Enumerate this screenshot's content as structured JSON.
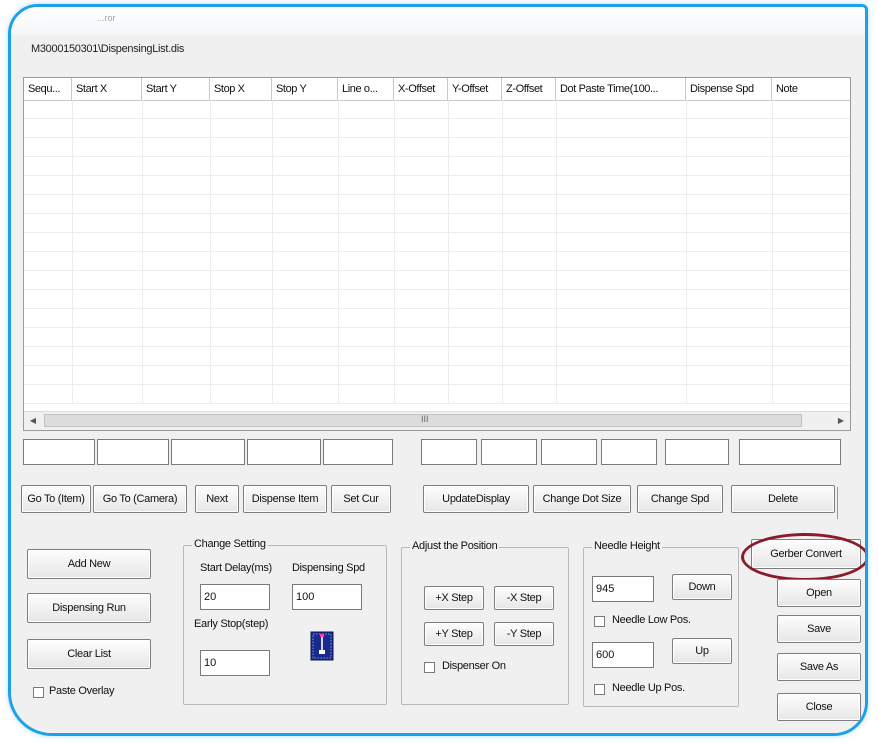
{
  "window": {
    "title": "...ror",
    "path": "M3000150301\\DispensingList.dis"
  },
  "grid": {
    "columns": [
      "Sequ...",
      "Start X",
      "Start Y",
      "Stop X",
      "Stop Y",
      "Line o...",
      "X-Offset",
      "Y-Offset",
      "Z-Offset",
      "Dot Paste Time(100...",
      "Dispense Spd",
      "Note"
    ],
    "scroll_grip": "III"
  },
  "edit_fields": [
    "",
    "",
    "",
    "",
    "",
    "",
    "",
    "",
    "",
    "",
    ""
  ],
  "action_buttons": {
    "goto_item": "Go To (Item)",
    "goto_camera": "Go To (Camera)",
    "next": "Next",
    "dispense_item": "Dispense Item",
    "set_cur": "Set Cur",
    "update_display": "UpdateDisplay",
    "change_dot_size": "Change Dot Size",
    "change_spd": "Change Spd",
    "delete": "Delete"
  },
  "left_buttons": {
    "add_new": "Add New",
    "dispensing_run": "Dispensing Run",
    "clear_list": "Clear List",
    "paste_overlay": "Paste Overlay"
  },
  "change_setting": {
    "title": "Change Setting",
    "start_delay_label": "Start Delay(ms)",
    "start_delay_value": "20",
    "dispensing_spd_label": "Dispensing Spd",
    "dispensing_spd_value": "100",
    "early_stop_label": "Early Stop(step)",
    "early_stop_value": "10"
  },
  "adjust_position": {
    "title": "Adjust the Position",
    "plus_x": "+X Step",
    "minus_x": "-X Step",
    "plus_y": "+Y Step",
    "minus_y": "-Y Step",
    "dispenser_on": "Dispenser On"
  },
  "needle_height": {
    "title": "Needle Height",
    "low_value": "945",
    "down": "Down",
    "low_pos": "Needle Low Pos.",
    "up_value": "600",
    "up": "Up",
    "up_pos": "Needle Up Pos."
  },
  "right_buttons": {
    "gerber_convert": "Gerber Convert",
    "open": "Open",
    "save": "Save",
    "save_as": "Save As",
    "close": "Close"
  },
  "colors": {
    "frame_border": "#1ea0e6",
    "highlight_ring": "#8b1a2a",
    "chip_icon_bg": "#1a2a8c"
  }
}
